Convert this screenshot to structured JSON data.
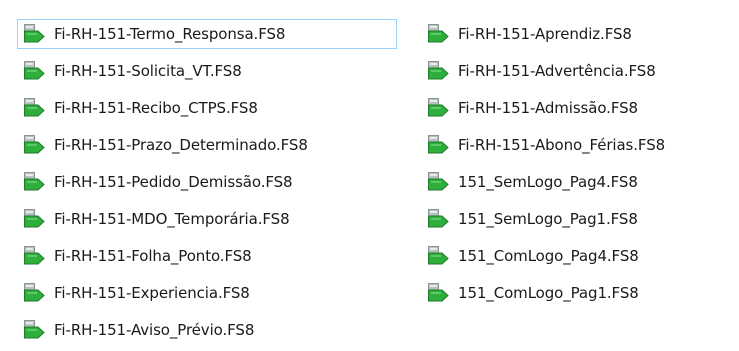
{
  "file_view": {
    "icon_name": "fs8-file-icon",
    "accent": "#99d1ff",
    "icon_colors": {
      "green": "#2eaf3c",
      "gray": "#b8c0c0"
    },
    "left_column": [
      {
        "name": "Fi-RH-151-Termo_Responsa.FS8"
      },
      {
        "name": "Fi-RH-151-Solicita_VT.FS8"
      },
      {
        "name": "Fi-RH-151-Recibo_CTPS.FS8"
      },
      {
        "name": "Fi-RH-151-Prazo_Determinado.FS8"
      },
      {
        "name": "Fi-RH-151-Pedido_Demissão.FS8"
      },
      {
        "name": "Fi-RH-151-MDO_Temporária.FS8"
      },
      {
        "name": "Fi-RH-151-Folha_Ponto.FS8"
      },
      {
        "name": "Fi-RH-151-Experiencia.FS8"
      },
      {
        "name": "Fi-RH-151-Aviso_Prévio.FS8"
      }
    ],
    "right_column": [
      {
        "name": "Fi-RH-151-Aprendiz.FS8"
      },
      {
        "name": "Fi-RH-151-Advertência.FS8"
      },
      {
        "name": "Fi-RH-151-Admissão.FS8"
      },
      {
        "name": "Fi-RH-151-Abono_Férias.FS8"
      },
      {
        "name": "151_SemLogo_Pag4.FS8"
      },
      {
        "name": "151_SemLogo_Pag1.FS8"
      },
      {
        "name": "151_ComLogo_Pag4.FS8"
      },
      {
        "name": "151_ComLogo_Pag1.FS8"
      }
    ]
  }
}
